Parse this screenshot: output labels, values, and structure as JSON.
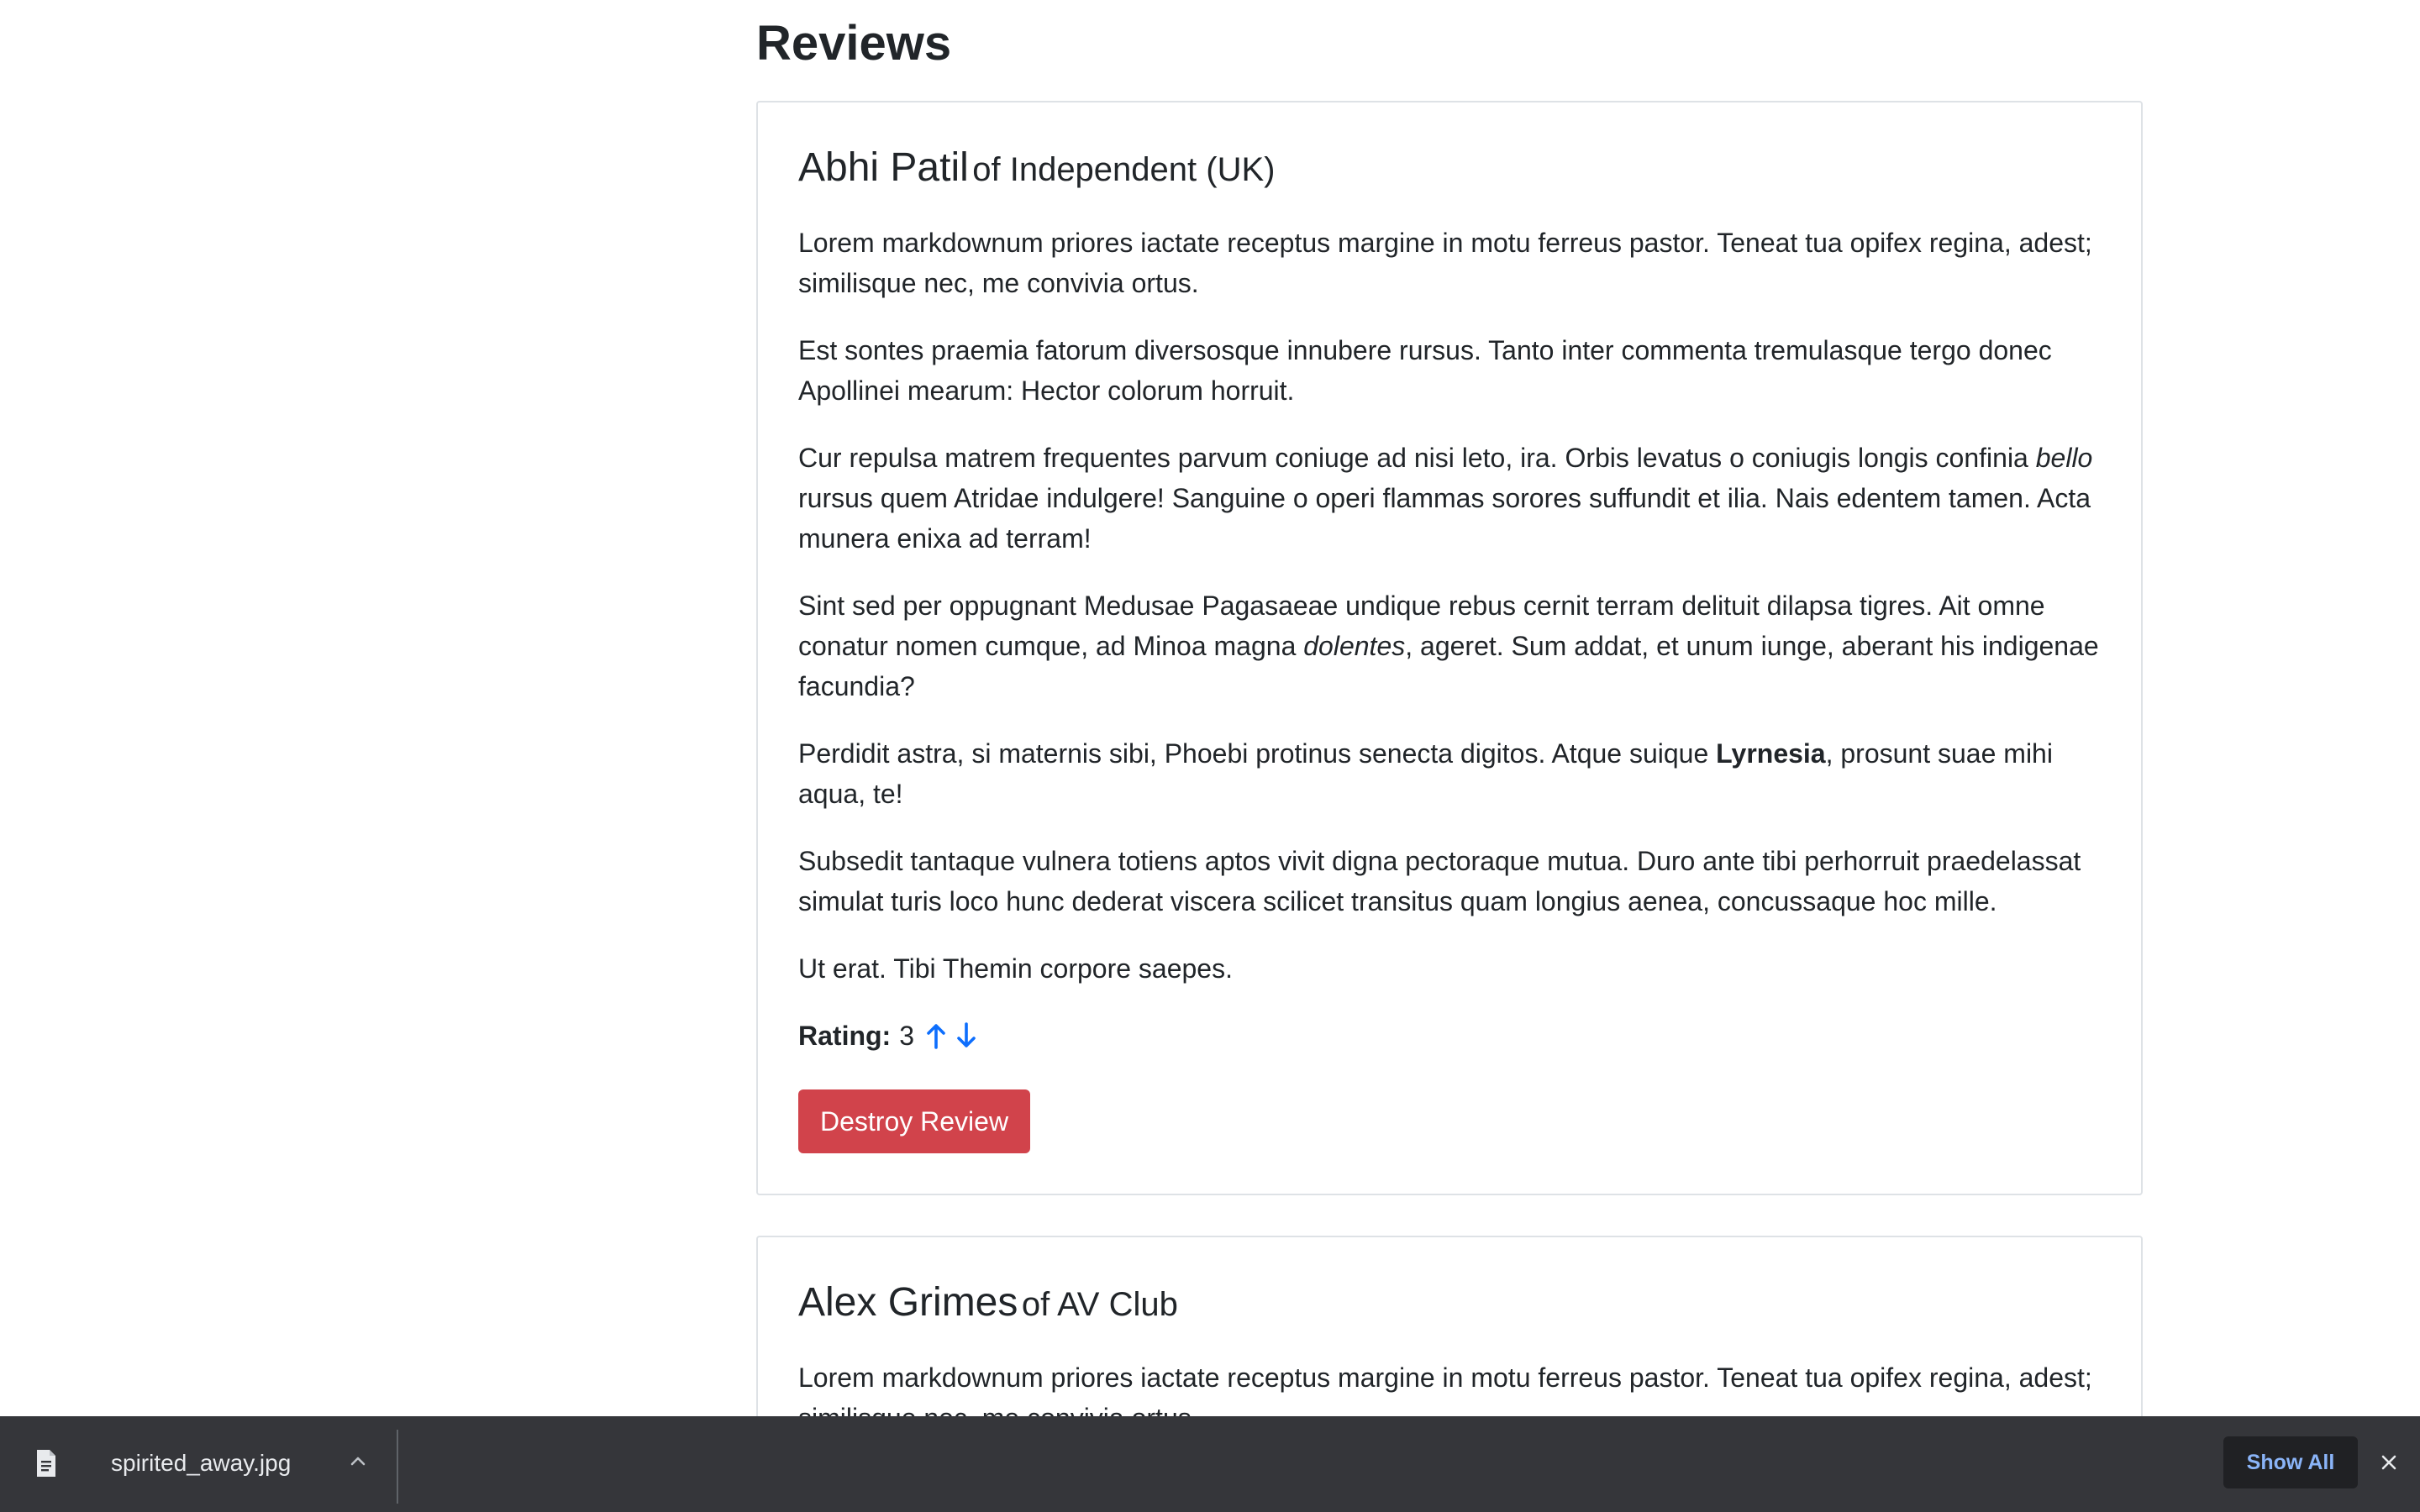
{
  "section": {
    "title": "Reviews"
  },
  "reviews": [
    {
      "name": "Abhi Patil",
      "of_text": "of Independent (UK)",
      "p1": "Lorem markdownum priores iactate receptus margine in motu ferreus pastor. Teneat tua opifex regina, adest; similisque nec, me convivia ortus.",
      "p2": "Est sontes praemia fatorum diversosque innubere rursus. Tanto inter commenta tremulasque tergo donec Apollinei mearum: Hector colorum horruit.",
      "p3": {
        "a": "Cur repulsa matrem frequentes parvum coniuge ad nisi leto, ira. Orbis levatus o coniugis longis confinia ",
        "em": "bello",
        "b": " rursus quem Atridae indulgere! Sanguine o operi flammas sorores suffundit et ilia. Nais edentem tamen. Acta munera enixa ad terram!"
      },
      "p4": {
        "a": "Sint sed per oppugnant Medusae Pagasaeae undique rebus cernit terram delituit dilapsa tigres. Ait omne conatur nomen cumque, ad Minoa magna ",
        "em": "dolentes",
        "b": ", ageret. Sum addat, et unum iunge, aberant his indigenae facundia?"
      },
      "p5": {
        "a": "Perdidit astra, si maternis sibi, Phoebi protinus senecta digitos. Atque suique ",
        "strong": "Lyrnesia",
        "b": ", prosunt suae mihi aqua, te!"
      },
      "p6": "Subsedit tantaque vulnera totiens aptos vivit digna pectoraque mutua. Duro ante tibi perhorruit praedelassat simulat turis loco hunc dederat viscera scilicet transitus quam longius aenea, concussaque hoc mille.",
      "p7": "Ut erat. Tibi Themin corpore saepes.",
      "rating_label": "Rating:",
      "rating_value": "3",
      "destroy_label": "Destroy Review"
    },
    {
      "name": "Alex Grimes",
      "of_text": "of AV Club",
      "p1": "Lorem markdownum priores iactate receptus margine in motu ferreus pastor. Teneat tua opifex regina, adest; similisque nec, me convivia ortus."
    }
  ],
  "download_bar": {
    "filename": "spirited_away.jpg",
    "show_all_label": "Show All",
    "icons": [
      "file-icon",
      "chevron-up-icon",
      "close-icon"
    ]
  },
  "colors": {
    "danger": "#d1434b",
    "link": "#0d6efd",
    "download_bar_bg": "#35363a",
    "show_all_text": "#8ab4f8"
  }
}
